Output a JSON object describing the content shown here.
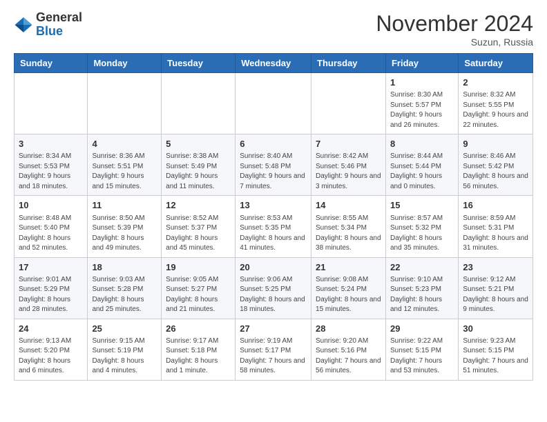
{
  "header": {
    "logo_general": "General",
    "logo_blue": "Blue",
    "month_title": "November 2024",
    "subtitle": "Suzun, Russia"
  },
  "days_of_week": [
    "Sunday",
    "Monday",
    "Tuesday",
    "Wednesday",
    "Thursday",
    "Friday",
    "Saturday"
  ],
  "weeks": [
    [
      {
        "day": "",
        "info": ""
      },
      {
        "day": "",
        "info": ""
      },
      {
        "day": "",
        "info": ""
      },
      {
        "day": "",
        "info": ""
      },
      {
        "day": "",
        "info": ""
      },
      {
        "day": "1",
        "info": "Sunrise: 8:30 AM\nSunset: 5:57 PM\nDaylight: 9 hours and 26 minutes."
      },
      {
        "day": "2",
        "info": "Sunrise: 8:32 AM\nSunset: 5:55 PM\nDaylight: 9 hours and 22 minutes."
      }
    ],
    [
      {
        "day": "3",
        "info": "Sunrise: 8:34 AM\nSunset: 5:53 PM\nDaylight: 9 hours and 18 minutes."
      },
      {
        "day": "4",
        "info": "Sunrise: 8:36 AM\nSunset: 5:51 PM\nDaylight: 9 hours and 15 minutes."
      },
      {
        "day": "5",
        "info": "Sunrise: 8:38 AM\nSunset: 5:49 PM\nDaylight: 9 hours and 11 minutes."
      },
      {
        "day": "6",
        "info": "Sunrise: 8:40 AM\nSunset: 5:48 PM\nDaylight: 9 hours and 7 minutes."
      },
      {
        "day": "7",
        "info": "Sunrise: 8:42 AM\nSunset: 5:46 PM\nDaylight: 9 hours and 3 minutes."
      },
      {
        "day": "8",
        "info": "Sunrise: 8:44 AM\nSunset: 5:44 PM\nDaylight: 9 hours and 0 minutes."
      },
      {
        "day": "9",
        "info": "Sunrise: 8:46 AM\nSunset: 5:42 PM\nDaylight: 8 hours and 56 minutes."
      }
    ],
    [
      {
        "day": "10",
        "info": "Sunrise: 8:48 AM\nSunset: 5:40 PM\nDaylight: 8 hours and 52 minutes."
      },
      {
        "day": "11",
        "info": "Sunrise: 8:50 AM\nSunset: 5:39 PM\nDaylight: 8 hours and 49 minutes."
      },
      {
        "day": "12",
        "info": "Sunrise: 8:52 AM\nSunset: 5:37 PM\nDaylight: 8 hours and 45 minutes."
      },
      {
        "day": "13",
        "info": "Sunrise: 8:53 AM\nSunset: 5:35 PM\nDaylight: 8 hours and 41 minutes."
      },
      {
        "day": "14",
        "info": "Sunrise: 8:55 AM\nSunset: 5:34 PM\nDaylight: 8 hours and 38 minutes."
      },
      {
        "day": "15",
        "info": "Sunrise: 8:57 AM\nSunset: 5:32 PM\nDaylight: 8 hours and 35 minutes."
      },
      {
        "day": "16",
        "info": "Sunrise: 8:59 AM\nSunset: 5:31 PM\nDaylight: 8 hours and 31 minutes."
      }
    ],
    [
      {
        "day": "17",
        "info": "Sunrise: 9:01 AM\nSunset: 5:29 PM\nDaylight: 8 hours and 28 minutes."
      },
      {
        "day": "18",
        "info": "Sunrise: 9:03 AM\nSunset: 5:28 PM\nDaylight: 8 hours and 25 minutes."
      },
      {
        "day": "19",
        "info": "Sunrise: 9:05 AM\nSunset: 5:27 PM\nDaylight: 8 hours and 21 minutes."
      },
      {
        "day": "20",
        "info": "Sunrise: 9:06 AM\nSunset: 5:25 PM\nDaylight: 8 hours and 18 minutes."
      },
      {
        "day": "21",
        "info": "Sunrise: 9:08 AM\nSunset: 5:24 PM\nDaylight: 8 hours and 15 minutes."
      },
      {
        "day": "22",
        "info": "Sunrise: 9:10 AM\nSunset: 5:23 PM\nDaylight: 8 hours and 12 minutes."
      },
      {
        "day": "23",
        "info": "Sunrise: 9:12 AM\nSunset: 5:21 PM\nDaylight: 8 hours and 9 minutes."
      }
    ],
    [
      {
        "day": "24",
        "info": "Sunrise: 9:13 AM\nSunset: 5:20 PM\nDaylight: 8 hours and 6 minutes."
      },
      {
        "day": "25",
        "info": "Sunrise: 9:15 AM\nSunset: 5:19 PM\nDaylight: 8 hours and 4 minutes."
      },
      {
        "day": "26",
        "info": "Sunrise: 9:17 AM\nSunset: 5:18 PM\nDaylight: 8 hours and 1 minute."
      },
      {
        "day": "27",
        "info": "Sunrise: 9:19 AM\nSunset: 5:17 PM\nDaylight: 7 hours and 58 minutes."
      },
      {
        "day": "28",
        "info": "Sunrise: 9:20 AM\nSunset: 5:16 PM\nDaylight: 7 hours and 56 minutes."
      },
      {
        "day": "29",
        "info": "Sunrise: 9:22 AM\nSunset: 5:15 PM\nDaylight: 7 hours and 53 minutes."
      },
      {
        "day": "30",
        "info": "Sunrise: 9:23 AM\nSunset: 5:15 PM\nDaylight: 7 hours and 51 minutes."
      }
    ]
  ]
}
